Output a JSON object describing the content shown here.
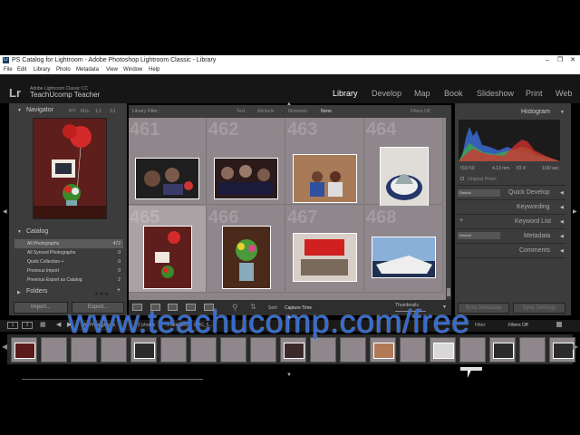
{
  "window": {
    "icon_text": "Lr",
    "title": "PS Catalog for Lightroom - Adobe Photoshop Lightroom Classic - Library",
    "buttons": [
      "–",
      "❐",
      "✕"
    ]
  },
  "menu": [
    "File",
    "Edit",
    "Library",
    "Photo",
    "Metadata",
    "View",
    "Window",
    "Help"
  ],
  "identity": {
    "logo": "Lr",
    "product": "Adobe Lightroom Classic CC",
    "plate": "TeachUcomp Teacher"
  },
  "modules": [
    {
      "label": "Library",
      "active": true
    },
    {
      "label": "Develop",
      "active": false
    },
    {
      "label": "Map",
      "active": false
    },
    {
      "label": "Book",
      "active": false
    },
    {
      "label": "Slideshow",
      "active": false
    },
    {
      "label": "Print",
      "active": false
    },
    {
      "label": "Web",
      "active": false
    }
  ],
  "left_panel": {
    "navigator_label": "Navigator",
    "nav_options": [
      "FIT",
      "FILL",
      "1:1",
      "3:1"
    ],
    "catalog_label": "Catalog",
    "catalog_items": [
      {
        "label": "All Photographs",
        "count": "472",
        "selected": true
      },
      {
        "label": "All Synced Photographs",
        "count": "0",
        "selected": false
      },
      {
        "label": "Quick Collection +",
        "count": "0",
        "selected": false
      },
      {
        "label": "Previous Import",
        "count": "0",
        "selected": false
      },
      {
        "label": "Previous Export as Catalog",
        "count": "2",
        "selected": false
      }
    ],
    "folders_label": "Folders",
    "import_button": "Import...",
    "export_button": "Export..."
  },
  "library_filter": {
    "label": "Library Filter :",
    "options": [
      "Text",
      "Attribute",
      "Metadata",
      "None"
    ],
    "filters": "Filters Off"
  },
  "grid": {
    "cells": [
      {
        "num": "461",
        "color": "#2b2b2b"
      },
      {
        "num": "462",
        "color": "#3a2a2a"
      },
      {
        "num": "463",
        "color": "#b07a56"
      },
      {
        "num": "464",
        "color": "#d8d8d8"
      },
      {
        "num": "465",
        "color": "#6a1f1f"
      },
      {
        "num": "466",
        "color": "#4a3a2a"
      },
      {
        "num": "467",
        "color": "#c23030"
      },
      {
        "num": "468",
        "color": "#7aa0c8"
      }
    ],
    "rating": "★★★"
  },
  "toolbar": {
    "sort_label": "Sort:",
    "sort_value": "Capture Time",
    "thumbnails_label": "Thumbnails"
  },
  "right_panel": {
    "histogram_label": "Histogram",
    "hist_info": [
      "ISO 50",
      "4.13 mm",
      "f/2.4",
      "1/30 sec"
    ],
    "original_photo": "Original Photo",
    "preset_default": "Default",
    "quick_develop": "Quick Develop",
    "keywording": "Keywording",
    "keyword_list": "Keyword List",
    "metadata": "Metadata",
    "comments": "Comments",
    "sync_metadata": "Sync Metadata",
    "sync_settings": "Sync Settings"
  },
  "filmstrip_bar": {
    "page1": "1",
    "page2": "2",
    "path": "All Photographs",
    "count": "2 photos",
    "selected": "1 selected",
    "file": "/IMG_5...",
    "filter_label": "Filter:",
    "filters_off": "Filters Off"
  },
  "filmstrip": {
    "thumbs": [
      "#5a1c1a",
      "#8f878b",
      "#8f878b",
      "#8f878b",
      "#2b2b2b",
      "#8f878b",
      "#8f878b",
      "#8f878b",
      "#8f878b",
      "#3a2a2a",
      "#8f878b",
      "#8f878b",
      "#b07a56",
      "#8f878b",
      "#d8d8d8",
      "#8f878b",
      "#2b2b2b",
      "#8f878b",
      "#2b2b2b"
    ]
  },
  "watermark": "www.teachucomp.com/free"
}
